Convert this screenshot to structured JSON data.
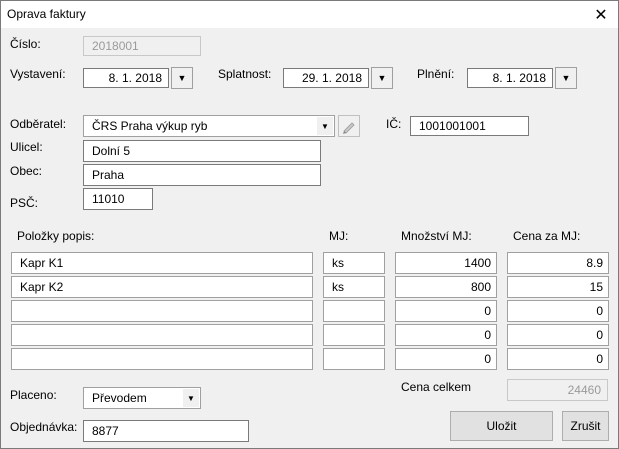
{
  "window": {
    "title": "Oprava faktury",
    "close_glyph": "✕"
  },
  "invoice": {
    "cislo_label": "Číslo:",
    "cislo": "2018001",
    "vystaveni_label": "Vystavení:",
    "vystaveni": "8. 1. 2018",
    "splatnost_label": "Splatnost:",
    "splatnost": "29. 1. 2018",
    "plneni_label": "Plnění:",
    "plneni": "8. 1. 2018"
  },
  "customer": {
    "odberatel_label": "Odběratel:",
    "odberatel": "ČRS Praha výkup ryb",
    "ic_label": "IČ:",
    "ic": "1001001001",
    "ulice_label": "Ulicel:",
    "ulice": "Dolní 5",
    "obec_label": "Obec:",
    "obec": "Praha",
    "psc_label": "PSČ:",
    "psc": "11010"
  },
  "items": {
    "headers": {
      "popis": "Položky popis:",
      "mj": "MJ:",
      "mnozstvi": "Množství MJ:",
      "cena": "Cena za MJ:"
    },
    "rows": [
      {
        "popis": "Kapr K1",
        "mj": "ks",
        "mnozstvi": "1400",
        "cena": "8.9"
      },
      {
        "popis": "Kapr K2",
        "mj": "ks",
        "mnozstvi": "800",
        "cena": "15"
      },
      {
        "popis": "",
        "mj": "",
        "mnozstvi": "0",
        "cena": "0"
      },
      {
        "popis": "",
        "mj": "",
        "mnozstvi": "0",
        "cena": "0"
      },
      {
        "popis": "",
        "mj": "",
        "mnozstvi": "0",
        "cena": "0"
      }
    ]
  },
  "footer": {
    "placeno_label": "Placeno:",
    "placeno": "Převodem",
    "objednavka_label": "Objednávka:",
    "objednavka": "8877",
    "cena_celkem_label": "Cena celkem",
    "cena_celkem": "24460",
    "ulozit": "Uložit",
    "zrusit": "Zrušit"
  },
  "icons": {
    "dropdown": "dropdown-arrow-icon",
    "pen": "pen-icon",
    "close": "close-icon"
  }
}
